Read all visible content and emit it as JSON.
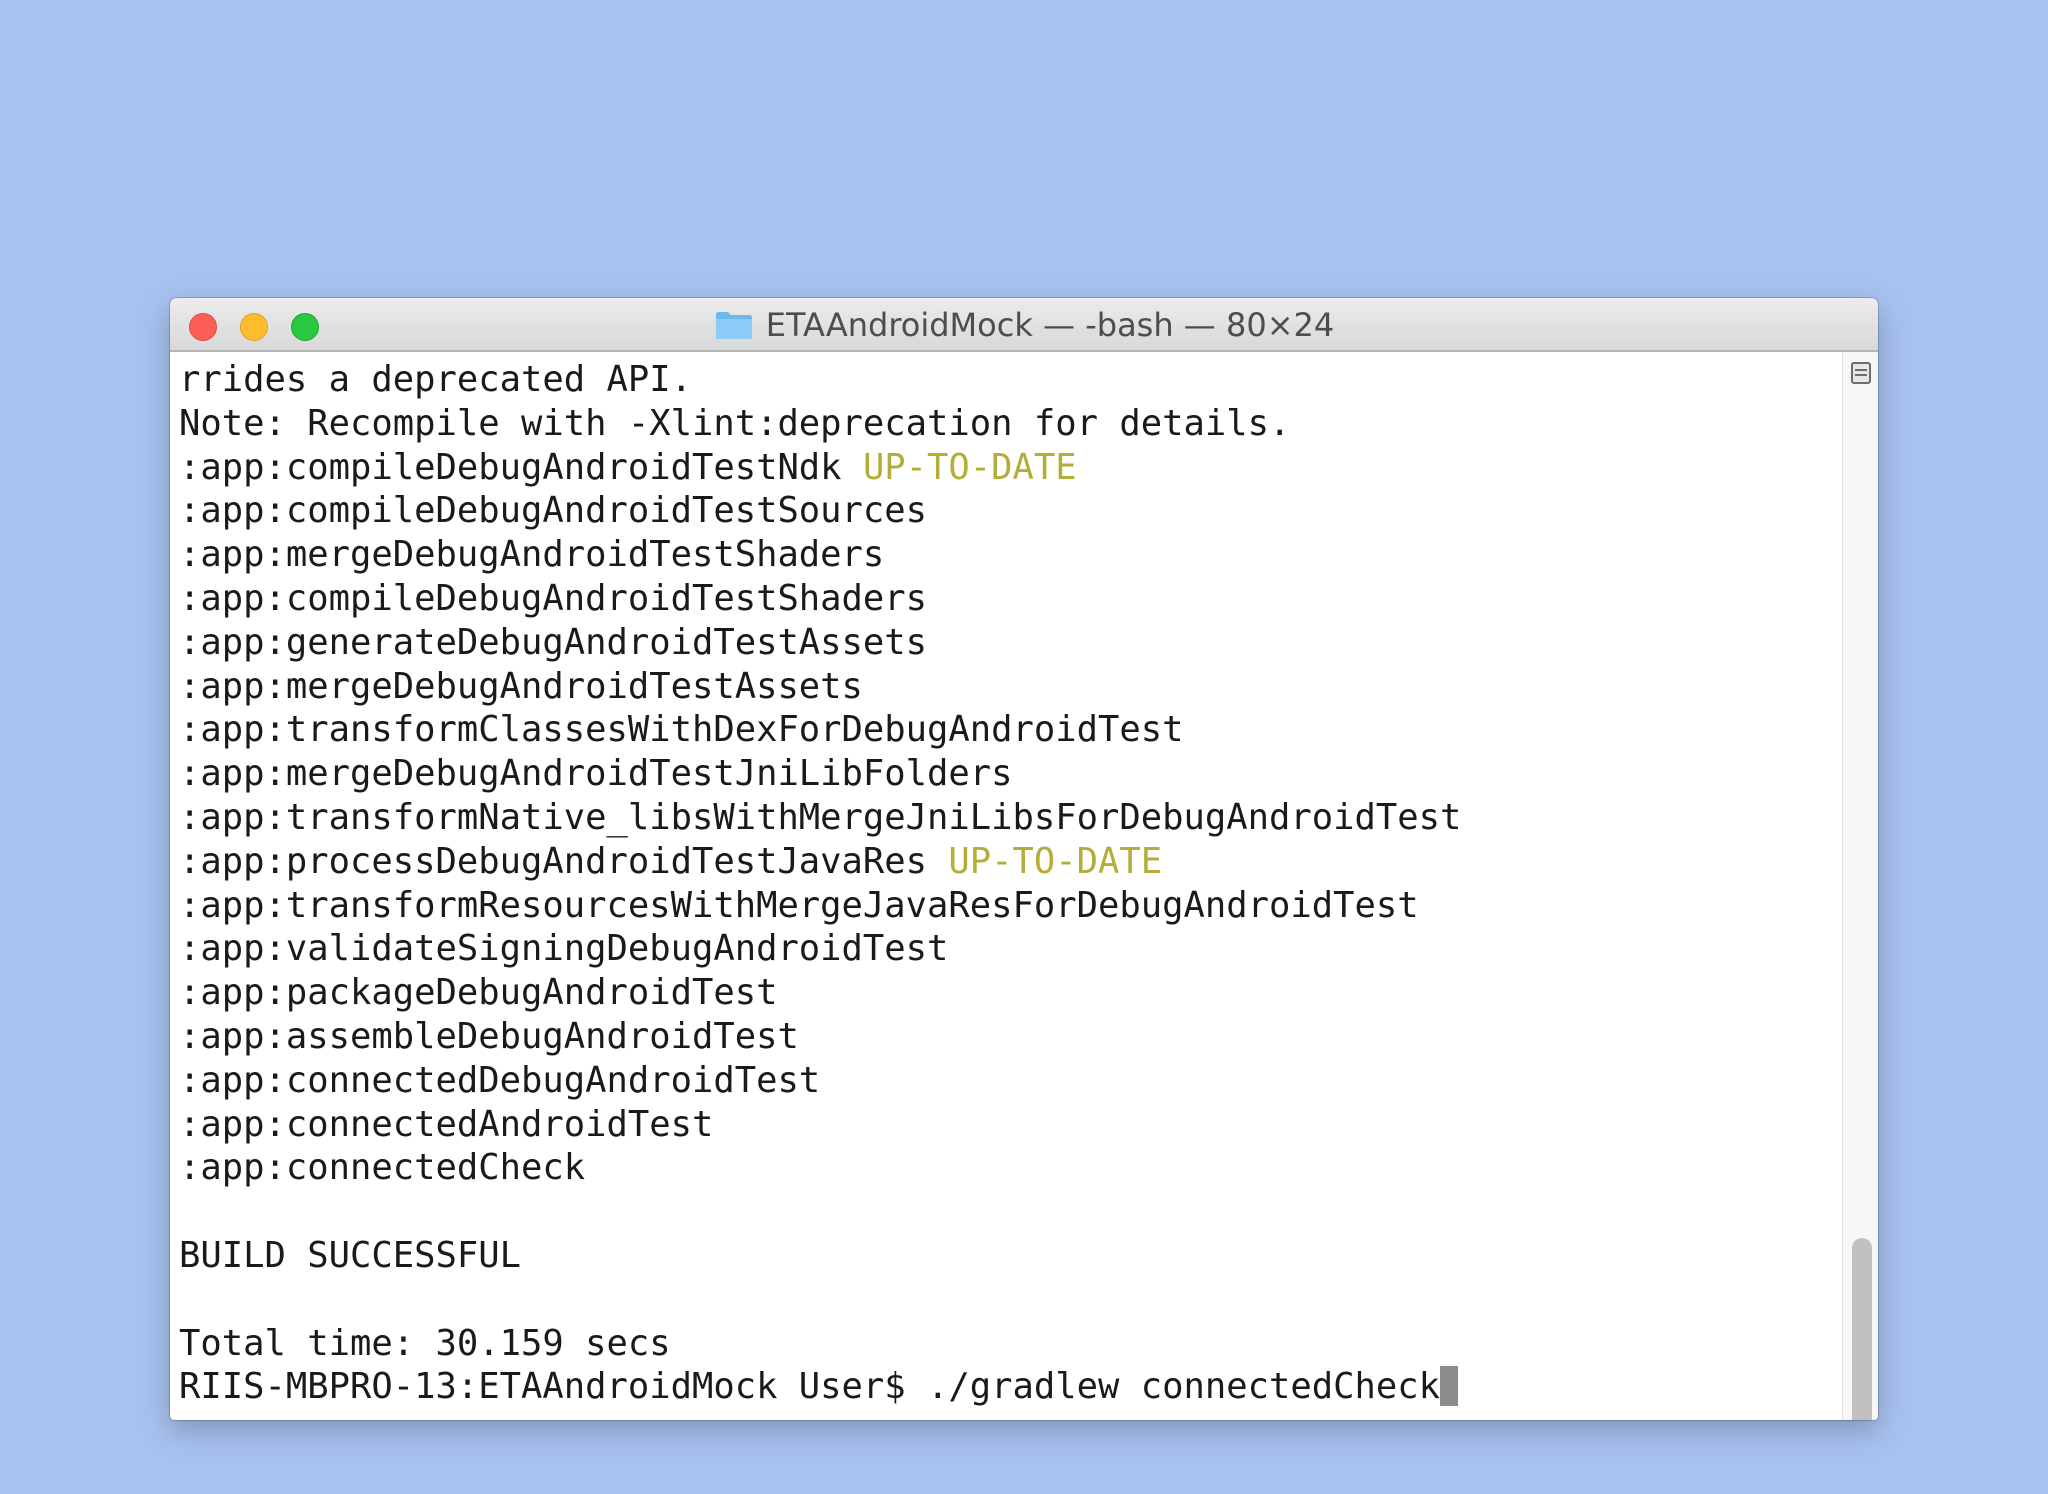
{
  "window": {
    "title": "ETAAndroidMock — -bash — 80×24",
    "title_icon": "folder-icon"
  },
  "terminal": {
    "lines": [
      {
        "text": "rrides a deprecated API.",
        "status": ""
      },
      {
        "text": "Note: Recompile with -Xlint:deprecation for details.",
        "status": ""
      },
      {
        "text": ":app:compileDebugAndroidTestNdk ",
        "status": "UP-TO-DATE"
      },
      {
        "text": ":app:compileDebugAndroidTestSources",
        "status": ""
      },
      {
        "text": ":app:mergeDebugAndroidTestShaders",
        "status": ""
      },
      {
        "text": ":app:compileDebugAndroidTestShaders",
        "status": ""
      },
      {
        "text": ":app:generateDebugAndroidTestAssets",
        "status": ""
      },
      {
        "text": ":app:mergeDebugAndroidTestAssets",
        "status": ""
      },
      {
        "text": ":app:transformClassesWithDexForDebugAndroidTest",
        "status": ""
      },
      {
        "text": ":app:mergeDebugAndroidTestJniLibFolders",
        "status": ""
      },
      {
        "text": ":app:transformNative_libsWithMergeJniLibsForDebugAndroidTest",
        "status": ""
      },
      {
        "text": ":app:processDebugAndroidTestJavaRes ",
        "status": "UP-TO-DATE"
      },
      {
        "text": ":app:transformResourcesWithMergeJavaResForDebugAndroidTest",
        "status": ""
      },
      {
        "text": ":app:validateSigningDebugAndroidTest",
        "status": ""
      },
      {
        "text": ":app:packageDebugAndroidTest",
        "status": ""
      },
      {
        "text": ":app:assembleDebugAndroidTest",
        "status": ""
      },
      {
        "text": ":app:connectedDebugAndroidTest",
        "status": ""
      },
      {
        "text": ":app:connectedAndroidTest",
        "status": ""
      },
      {
        "text": ":app:connectedCheck",
        "status": ""
      },
      {
        "text": "",
        "status": ""
      },
      {
        "text": "BUILD SUCCESSFUL",
        "status": ""
      },
      {
        "text": "",
        "status": ""
      },
      {
        "text": "Total time: 30.159 secs",
        "status": ""
      }
    ],
    "prompt": "RIIS-MBPRO-13:ETAAndroidMock User$ ",
    "command": "./gradlew connectedCheck"
  },
  "colors": {
    "desktop": "#a8c2f0",
    "status_text": "#b5ad3a",
    "terminal_text": "#1a1a1a"
  }
}
